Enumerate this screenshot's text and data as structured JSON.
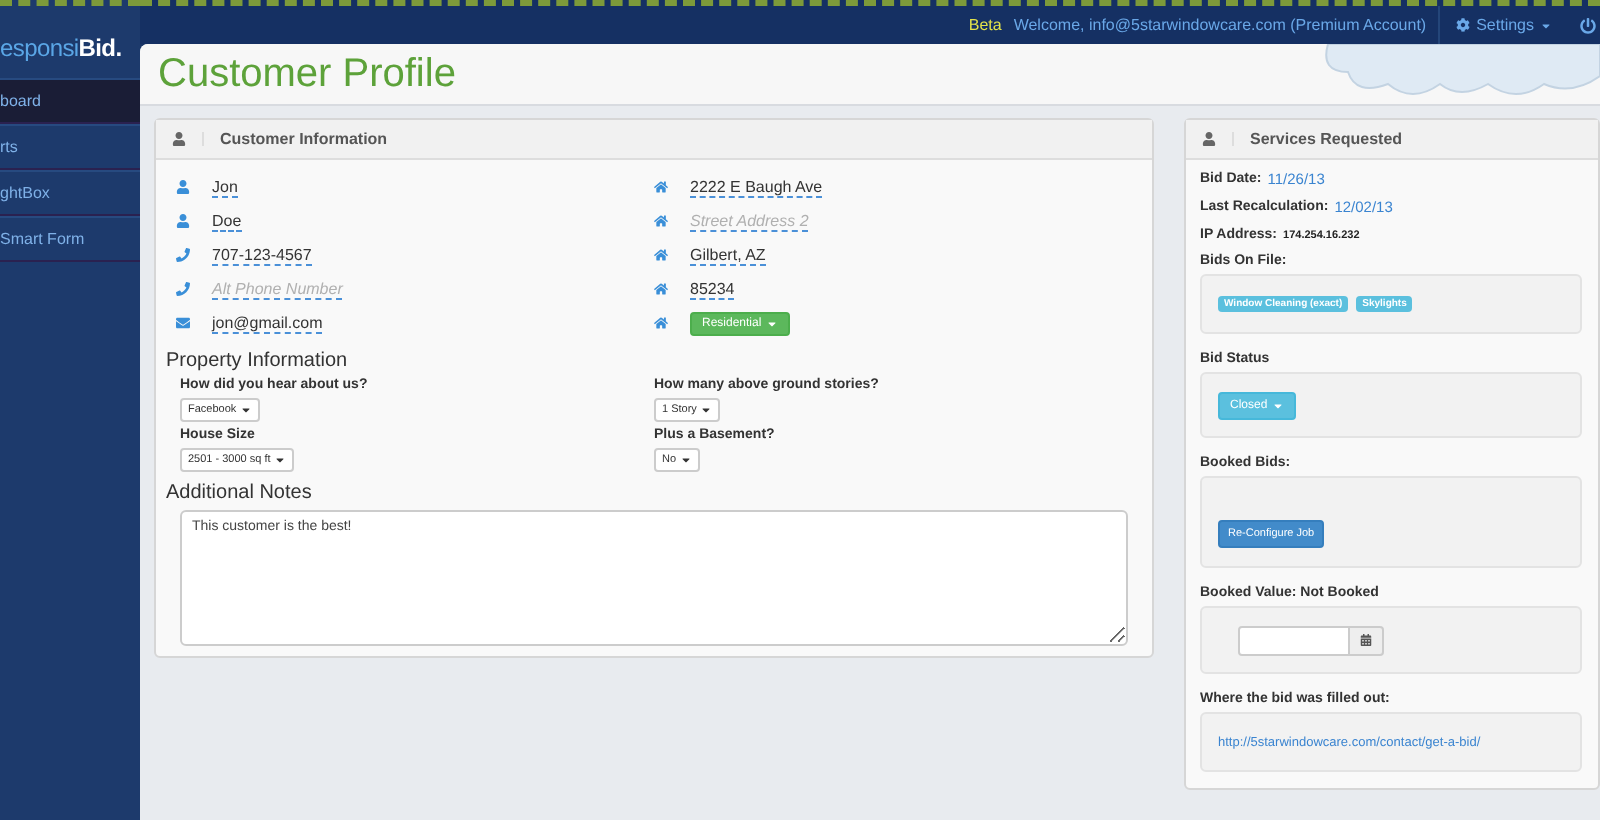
{
  "top_bar": {
    "badge": "Beta",
    "welcome": "Welcome, info@5starwindowcare.com (Premium Account)",
    "settings": "Settings"
  },
  "sidebar": {
    "logo": "esponsi**Bid.**",
    "items": [
      {
        "label": "board",
        "selected": true
      },
      {
        "label": "rts",
        "selected": false
      },
      {
        "label": "ghtBox",
        "selected": false
      },
      {
        "label": "Smart Form",
        "selected": false
      }
    ]
  },
  "page_title": "Customer Profile",
  "customer_info": {
    "title": "Customer Information",
    "left_fields": [
      {
        "kind": "name",
        "value": "Jon"
      },
      {
        "kind": "name",
        "value": "Doe"
      },
      {
        "kind": "phone",
        "value": "707-123-4567"
      },
      {
        "kind": "phone",
        "placeholder": "Alt Phone Number"
      },
      {
        "kind": "email",
        "value": "jon@gmail.com"
      }
    ],
    "right_fields": [
      {
        "kind": "address",
        "value": "2222 E Baugh Ave"
      },
      {
        "kind": "address",
        "placeholder": "Street Address 2"
      },
      {
        "kind": "address",
        "value": "Gilbert, AZ"
      },
      {
        "kind": "address",
        "value": "85234"
      },
      {
        "kind": "address",
        "dropdown": "Residential"
      }
    ]
  },
  "property": {
    "heading": "Property Information",
    "questions": [
      {
        "label": "How did you hear about us?",
        "value": "Facebook"
      },
      {
        "label": "How many above ground stories?",
        "value": "1 Story"
      },
      {
        "label": "House Size",
        "value": "2501 - 3000 sq ft"
      },
      {
        "label": "Plus a Basement?",
        "value": "No"
      }
    ]
  },
  "notes": {
    "heading": "Additional Notes",
    "value": "This customer is the best!"
  },
  "services": {
    "title": "Services Requested",
    "meta": [
      {
        "label": "Bid Date:",
        "value": "11/26/13",
        "kind": "link"
      },
      {
        "label": "Last Recalculation:",
        "value": "12/02/13",
        "kind": "link"
      },
      {
        "label": "IP Address:",
        "value": "174.254.16.232",
        "kind": "plain"
      }
    ],
    "bids_on_file": {
      "label": "Bids On File:",
      "tags": [
        "Window Cleaning (exact)",
        "Skylights"
      ]
    },
    "bid_status": {
      "label": "Bid Status",
      "value": "Closed"
    },
    "booked_bids": {
      "label": "Booked Bids:",
      "button": "Re-Configure Job"
    },
    "booked_value": {
      "label": "Booked Value: Not Booked"
    },
    "source": {
      "label": "Where the bid was filled out:",
      "url": "http://5starwindowcare.com/contact/get-a-bid/"
    }
  }
}
